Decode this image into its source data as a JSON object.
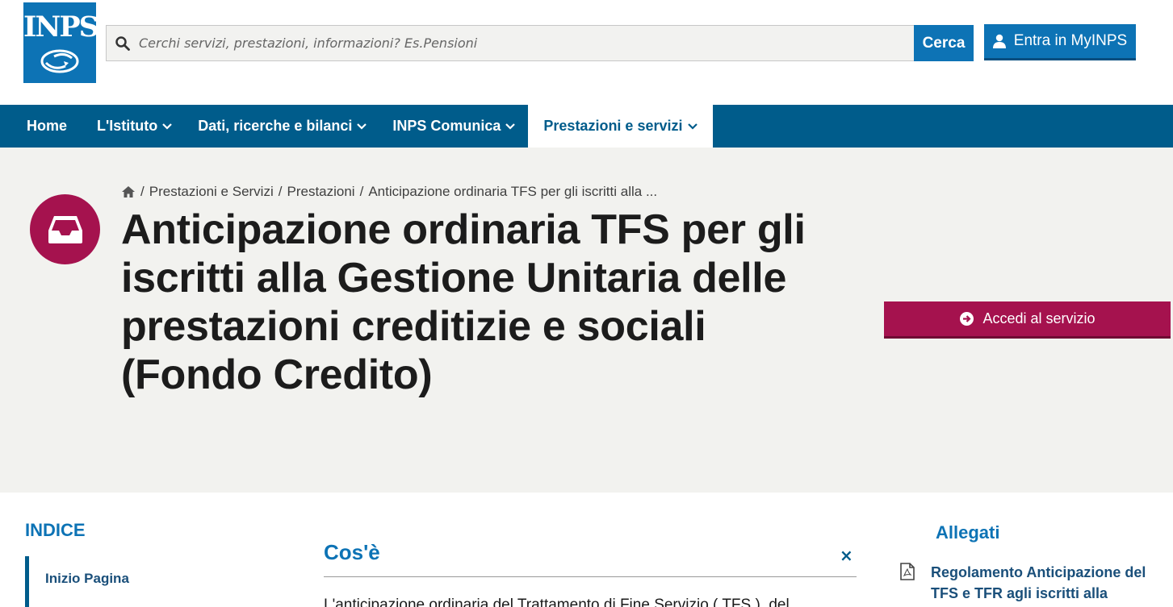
{
  "header": {
    "logo_text": "INPS",
    "search_placeholder": "Cerchi servizi, prestazioni, informazioni? Es.Pensioni",
    "search_button": "Cerca",
    "login_button": "Entra in MyINPS"
  },
  "nav": {
    "items": [
      {
        "label": "Home"
      },
      {
        "label": "L'Istituto"
      },
      {
        "label": "Dati, ricerche e bilanci"
      },
      {
        "label": "INPS Comunica"
      },
      {
        "label": "Prestazioni e servizi"
      }
    ]
  },
  "breadcrumb": {
    "items": [
      "Prestazioni e Servizi",
      "Prestazioni",
      "Anticipazione ordinaria TFS per gli iscritti alla ..."
    ],
    "separator": "/"
  },
  "hero": {
    "title": "Anticipazione ordinaria TFS per gli iscritti alla Gestione Unitaria delle prestazioni creditizie e sociali (Fondo Credito)",
    "service_button": "Accedi al servizio"
  },
  "indice": {
    "title": "INDICE",
    "items": [
      {
        "label": "Inizio Pagina"
      }
    ]
  },
  "section": {
    "title": "Cos'è",
    "close": "×",
    "text": "L'anticipazione ordinaria del Trattamento di Fine Servizio ( TFS ), del"
  },
  "allegati": {
    "title": "Allegati",
    "items": [
      {
        "label": "Regolamento Anticipazione del TFS e TFR agli iscritti alla"
      }
    ]
  },
  "colors": {
    "primary_blue": "#0d73b5",
    "nav_blue": "#005c8b",
    "accent_magenta": "#a5124e",
    "hero_bg": "#f2f2ef"
  }
}
